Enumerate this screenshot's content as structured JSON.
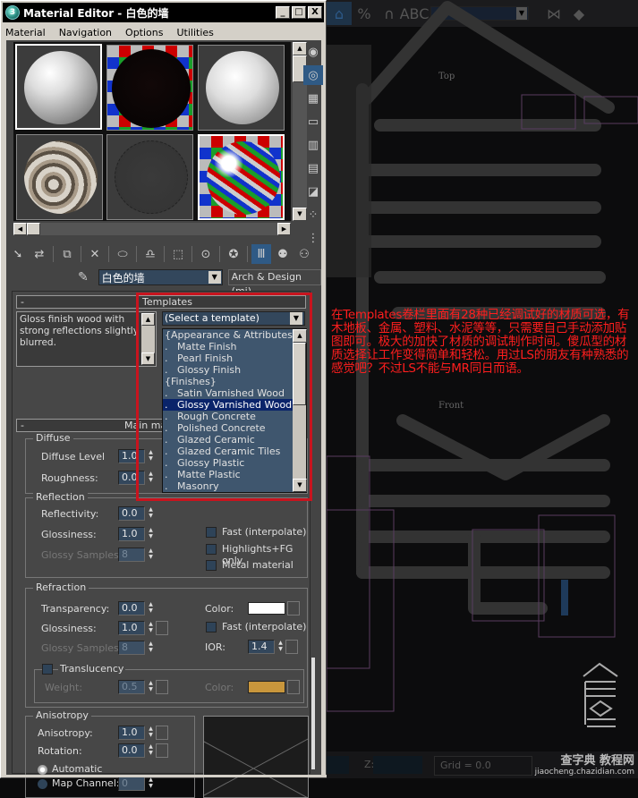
{
  "window": {
    "title": "Material Editor - 白色的墙",
    "minimize": "_",
    "maximize": "□",
    "close": "X"
  },
  "menu": [
    "Material",
    "Navigation",
    "Options",
    "Utilities"
  ],
  "material": {
    "name": "白色的墙",
    "type": "Arch & Design (mi)"
  },
  "rollouts": {
    "templates": {
      "title": "Templates",
      "collapse": "-",
      "description": "Gloss finish wood with strong reflections slightly blurred.",
      "selected": "(Select a template)",
      "options": [
        "{Appearance & Attributes}",
        ".   Matte Finish",
        ".   Pearl Finish",
        ".   Glossy Finish",
        "{Finishes}",
        ".   Satin Varnished Wood",
        ".   Glossy Varnished Wood",
        ".   Rough Concrete",
        ".   Polished Concrete",
        ".   Glazed Ceramic",
        ".   Glazed Ceramic Tiles",
        ".   Glossy Plastic",
        ".   Matte Plastic",
        ".   Masonry"
      ],
      "highlighted_index": 6
    },
    "main": {
      "title": "Main material parameters",
      "collapse": "-",
      "diffuse": {
        "label": "Diffuse",
        "level_label": "Diffuse Level",
        "level": "1.0",
        "roughness_label": "Roughness:",
        "roughness": "0.0"
      },
      "reflection": {
        "label": "Reflection",
        "reflectivity_label": "Reflectivity:",
        "reflectivity": "0.0",
        "glossiness_label": "Glossiness:",
        "glossiness": "1.0",
        "samples_label": "Glossy Samples",
        "samples": "8",
        "fast_label": "Fast (interpolate)",
        "highlights_label": "Highlights+FG only",
        "metal_label": "Metal material"
      },
      "refraction": {
        "label": "Refraction",
        "transparency_label": "Transparency:",
        "transparency": "0.0",
        "glossiness_label": "Glossiness:",
        "glossiness": "1.0",
        "samples_label": "Glossy Samples",
        "samples": "8",
        "color_label": "Color:",
        "color": "#ffffff",
        "fast_label": "Fast (interpolate)",
        "ior_label": "IOR:",
        "ior": "1.4",
        "translucency_label": "Translucency",
        "weight_label": "Weight:",
        "weight": "0.5",
        "trans_color_label": "Color:",
        "trans_color": "#c8963c"
      },
      "anisotropy": {
        "label": "Anisotropy",
        "anisotropy_label": "Anisotropy:",
        "anisotropy": "1.0",
        "rotation_label": "Rotation:",
        "rotation": "0.0",
        "automatic_label": "Automatic",
        "map_channel_label": "Map Channel:",
        "map_channel": "0"
      }
    }
  },
  "viewport": {
    "top_label": "Top",
    "front_label": "Front",
    "grid_label": "Grid = 0.0",
    "z_label": "Z:"
  },
  "annotation": "在Templates卷栏里面有28种已经调试好的材质可选，有木地板、金属、塑料、水泥等等，只需要自己手动添加贴图即可。极大的加快了材质的调试制作时间。傻瓜型的材质选择让工作变得简单和轻松。用过LS的朋友有种熟悉的感觉吧？不过LS不能与MR同日而语。",
  "watermark": {
    "text": "查字典 教程网",
    "url": "jiaocheng.chazidian.com"
  },
  "colors": {
    "annotation_red": "#ff1e1e",
    "highlight_box": "#c8141e",
    "selection_blue": "#0a246a"
  }
}
